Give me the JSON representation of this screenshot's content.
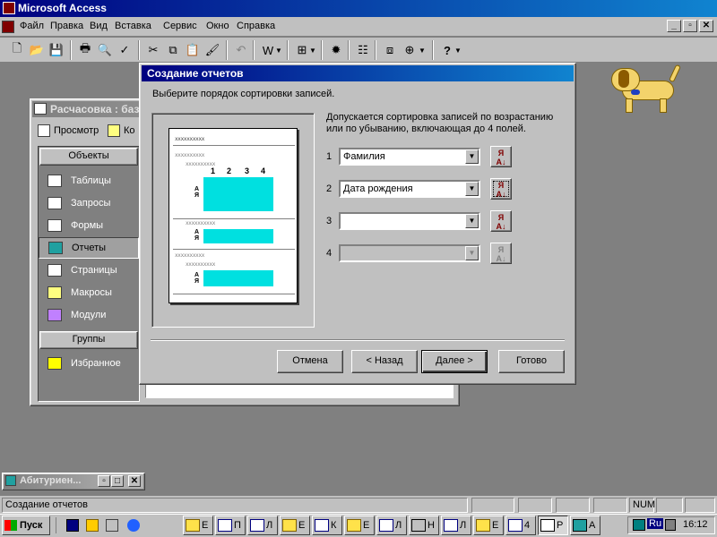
{
  "app": {
    "title": "Microsoft Access"
  },
  "menu": [
    "Файл",
    "Правка",
    "Вид",
    "Вставка",
    "Сервис",
    "Окно",
    "Справка"
  ],
  "db_window": {
    "title": "Расчасовка : баз",
    "toolbar_preview": "Просмотр",
    "toolbar_design": "Ко",
    "objects_header": "Объекты",
    "items": [
      {
        "label": "Таблицы",
        "icon": "table-icon"
      },
      {
        "label": "Запросы",
        "icon": "query-icon"
      },
      {
        "label": "Формы",
        "icon": "form-icon"
      },
      {
        "label": "Отчеты",
        "icon": "report-icon"
      },
      {
        "label": "Страницы",
        "icon": "page-icon"
      },
      {
        "label": "Макросы",
        "icon": "macro-icon"
      },
      {
        "label": "Модули",
        "icon": "module-icon"
      }
    ],
    "groups_header": "Группы",
    "favorites": "Избранное"
  },
  "wizard": {
    "title": "Создание отчетов",
    "subtitle": "Выберите порядок сортировки записей.",
    "instructions": "Допускается сортировка записей по возрастанию или по убыванию, включающая до 4 полей.",
    "fields": [
      {
        "num": "1",
        "value": "Фамилия",
        "enabled": true
      },
      {
        "num": "2",
        "value": "Дата рождения",
        "enabled": true
      },
      {
        "num": "3",
        "value": "",
        "enabled": true
      },
      {
        "num": "4",
        "value": "",
        "enabled": false
      }
    ],
    "buttons": {
      "cancel": "Отмена",
      "back": "< Назад",
      "next": "Далее >",
      "finish": "Готово"
    },
    "preview": {
      "placeholder": "xxxxxxxxxx",
      "columns": [
        "1",
        "2",
        "3",
        "4"
      ],
      "sort_az": "А Я"
    }
  },
  "minimized": {
    "title": "Абитуриен..."
  },
  "statusbar": {
    "text": "Создание отчетов",
    "num": "NUM"
  },
  "taskbar": {
    "start": "Пуск",
    "buttons": [
      "Е",
      "П",
      "Л",
      "Е",
      "К",
      "Е",
      "Л",
      "Н",
      "Л",
      "Е",
      "4",
      "Р",
      "А"
    ],
    "lang": "Ru",
    "clock": "16:12"
  },
  "colors": {
    "titlebar": "#000080",
    "face": "#c0c0c0",
    "preview_highlight": "#00e0e0"
  }
}
